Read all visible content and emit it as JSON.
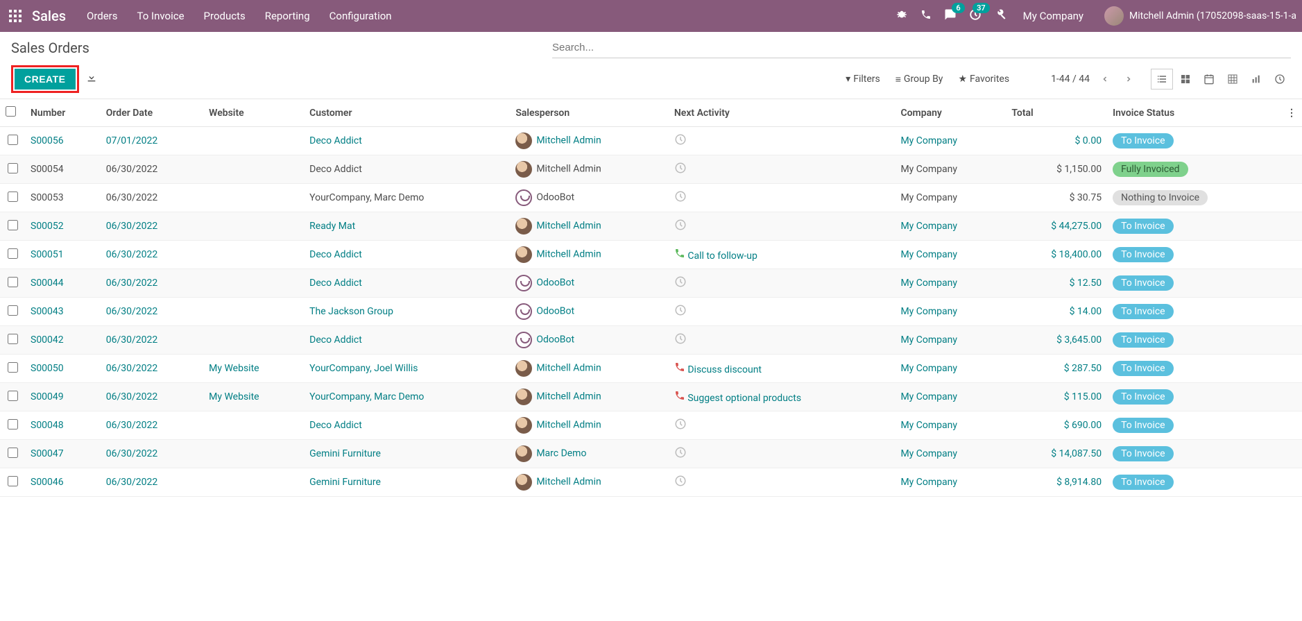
{
  "topnav": {
    "brand": "Sales",
    "menu": [
      "Orders",
      "To Invoice",
      "Products",
      "Reporting",
      "Configuration"
    ],
    "chat_badge": "6",
    "activity_badge": "37",
    "company": "My Company",
    "user": "Mitchell Admin (17052098-saas-15-1-a"
  },
  "cp": {
    "title": "Sales Orders",
    "create": "CREATE",
    "search_placeholder": "Search...",
    "filters": "Filters",
    "groupby": "Group By",
    "favorites": "Favorites",
    "pager": "1-44 / 44"
  },
  "columns": {
    "number": "Number",
    "order_date": "Order Date",
    "website": "Website",
    "customer": "Customer",
    "salesperson": "Salesperson",
    "next_activity": "Next Activity",
    "company": "Company",
    "total": "Total",
    "invoice_status": "Invoice Status"
  },
  "rows": [
    {
      "number": "S00056",
      "date": "07/01/2022",
      "website": "",
      "customer": "Deco Addict",
      "sp": "Mitchell Admin",
      "sp_av": "mitchell",
      "act": "",
      "act_kind": "clock",
      "company": "My Company",
      "total": "$ 0.00",
      "status": "To Invoice",
      "status_cls": "toinvoice",
      "link": true
    },
    {
      "number": "S00054",
      "date": "06/30/2022",
      "website": "",
      "customer": "Deco Addict",
      "sp": "Mitchell Admin",
      "sp_av": "mitchell",
      "act": "",
      "act_kind": "clock",
      "company": "My Company",
      "total": "$ 1,150.00",
      "status": "Fully Invoiced",
      "status_cls": "full",
      "link": false
    },
    {
      "number": "S00053",
      "date": "06/30/2022",
      "website": "",
      "customer": "YourCompany, Marc Demo",
      "sp": "OdooBot",
      "sp_av": "bot",
      "act": "",
      "act_kind": "clock",
      "company": "My Company",
      "total": "$ 30.75",
      "status": "Nothing to Invoice",
      "status_cls": "nothing",
      "link": false
    },
    {
      "number": "S00052",
      "date": "06/30/2022",
      "website": "",
      "customer": "Ready Mat",
      "sp": "Mitchell Admin",
      "sp_av": "mitchell",
      "act": "",
      "act_kind": "clock",
      "company": "My Company",
      "total": "$ 44,275.00",
      "status": "To Invoice",
      "status_cls": "toinvoice",
      "link": true
    },
    {
      "number": "S00051",
      "date": "06/30/2022",
      "website": "",
      "customer": "Deco Addict",
      "sp": "Mitchell Admin",
      "sp_av": "mitchell",
      "act": "Call to follow-up",
      "act_kind": "phone-green",
      "company": "My Company",
      "total": "$ 18,400.00",
      "status": "To Invoice",
      "status_cls": "toinvoice",
      "link": true
    },
    {
      "number": "S00044",
      "date": "06/30/2022",
      "website": "",
      "customer": "Deco Addict",
      "sp": "OdooBot",
      "sp_av": "bot",
      "act": "",
      "act_kind": "clock",
      "company": "My Company",
      "total": "$ 12.50",
      "status": "To Invoice",
      "status_cls": "toinvoice",
      "link": true
    },
    {
      "number": "S00043",
      "date": "06/30/2022",
      "website": "",
      "customer": "The Jackson Group",
      "sp": "OdooBot",
      "sp_av": "bot",
      "act": "",
      "act_kind": "clock",
      "company": "My Company",
      "total": "$ 14.00",
      "status": "To Invoice",
      "status_cls": "toinvoice",
      "link": true
    },
    {
      "number": "S00042",
      "date": "06/30/2022",
      "website": "",
      "customer": "Deco Addict",
      "sp": "OdooBot",
      "sp_av": "bot",
      "act": "",
      "act_kind": "clock",
      "company": "My Company",
      "total": "$ 3,645.00",
      "status": "To Invoice",
      "status_cls": "toinvoice",
      "link": true
    },
    {
      "number": "S00050",
      "date": "06/30/2022",
      "website": "My Website",
      "customer": "YourCompany, Joel Willis",
      "sp": "Mitchell Admin",
      "sp_av": "mitchell",
      "act": "Discuss discount",
      "act_kind": "phone-red",
      "company": "My Company",
      "total": "$ 287.50",
      "status": "To Invoice",
      "status_cls": "toinvoice",
      "link": true
    },
    {
      "number": "S00049",
      "date": "06/30/2022",
      "website": "My Website",
      "customer": "YourCompany, Marc Demo",
      "sp": "Mitchell Admin",
      "sp_av": "mitchell",
      "act": "Suggest optional products",
      "act_kind": "phone-red",
      "company": "My Company",
      "total": "$ 115.00",
      "status": "To Invoice",
      "status_cls": "toinvoice",
      "link": true
    },
    {
      "number": "S00048",
      "date": "06/30/2022",
      "website": "",
      "customer": "Deco Addict",
      "sp": "Mitchell Admin",
      "sp_av": "mitchell",
      "act": "",
      "act_kind": "clock",
      "company": "My Company",
      "total": "$ 690.00",
      "status": "To Invoice",
      "status_cls": "toinvoice",
      "link": true
    },
    {
      "number": "S00047",
      "date": "06/30/2022",
      "website": "",
      "customer": "Gemini Furniture",
      "sp": "Marc Demo",
      "sp_av": "mitchell",
      "act": "",
      "act_kind": "clock",
      "company": "My Company",
      "total": "$ 14,087.50",
      "status": "To Invoice",
      "status_cls": "toinvoice",
      "link": true
    },
    {
      "number": "S00046",
      "date": "06/30/2022",
      "website": "",
      "customer": "Gemini Furniture",
      "sp": "Mitchell Admin",
      "sp_av": "mitchell",
      "act": "",
      "act_kind": "clock",
      "company": "My Company",
      "total": "$ 8,914.80",
      "status": "To Invoice",
      "status_cls": "toinvoice",
      "link": true
    }
  ]
}
